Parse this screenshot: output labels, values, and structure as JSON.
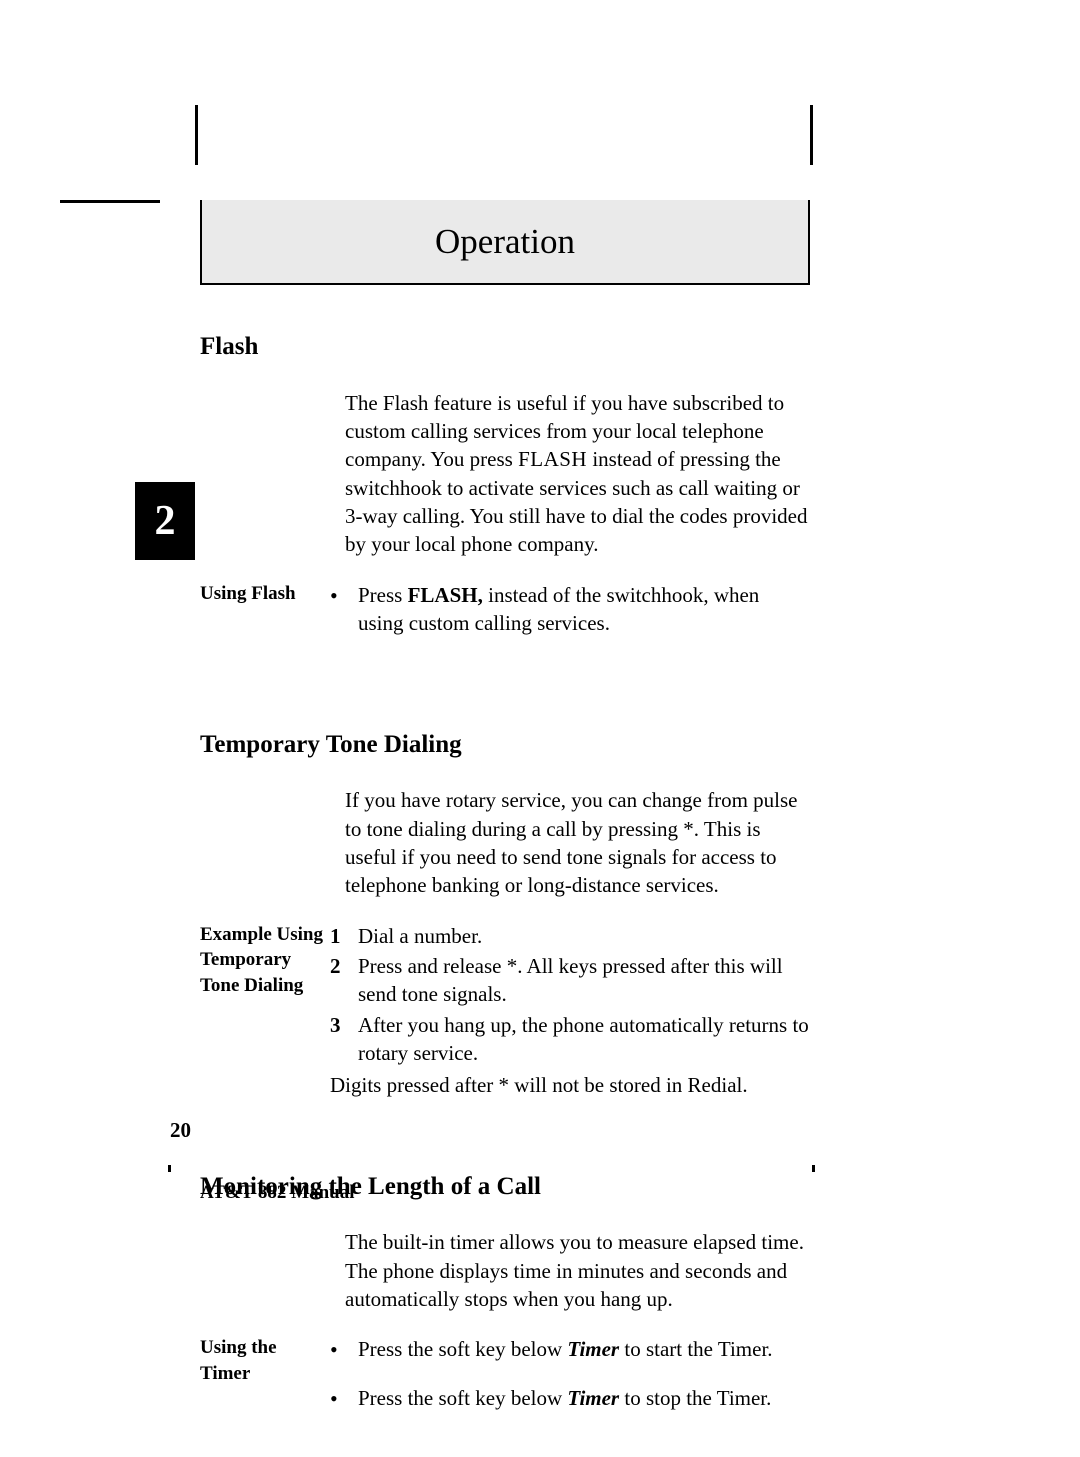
{
  "chapter": "2",
  "page_title": "Operation",
  "page_number": "20",
  "footer": "AT&T 882 Manual",
  "flash": {
    "heading": "Flash",
    "intro_pre": "The Flash feature is useful if you have subscribed to custom calling services from your local telephone company.  You press ",
    "intro_flash": "FLASH",
    "intro_post": " instead of pressing the switchhook to activate services such as call waiting or 3-way calling.  You still have to dial the codes provided by your local phone company.",
    "side": "Using Flash",
    "bul_pre": "Press ",
    "bul_flash": "FLASH,",
    "bul_post": " instead of the switchhook, when using custom calling services."
  },
  "tone": {
    "heading": "Temporary Tone Dialing",
    "intro_a": "If you have rotary service, you can change from pulse to tone dialing during a call by pressing ",
    "intro_star1": "*",
    "intro_b": ".  This is useful if you need to send tone signals for access to telephone banking or long-distance services.",
    "side": "Example Using Temporary Tone Dialing",
    "s1": "Dial a number.",
    "s2_a": "Press and release ",
    "s2_star": "*",
    "s2_b": ".  All keys pressed after this will send tone signals.",
    "s3": "After you hang up, the phone automatically returns to rotary service.",
    "note_a": "Digits pressed after ",
    "note_star": "*",
    "note_b": " will not be stored in Redial."
  },
  "timer": {
    "heading": "Monitoring the Length of a Call",
    "intro": "The built-in timer allows you to measure elapsed time.  The phone displays time in minutes and seconds and automatically stops when you hang up.",
    "side": "Using the Timer",
    "b1_a": "Press the soft key below ",
    "b1_t": "Timer",
    "b1_b": " to start the Timer.",
    "b2_a": "Press the soft key below ",
    "b2_t": "Timer",
    "b2_b": " to stop the Timer."
  }
}
